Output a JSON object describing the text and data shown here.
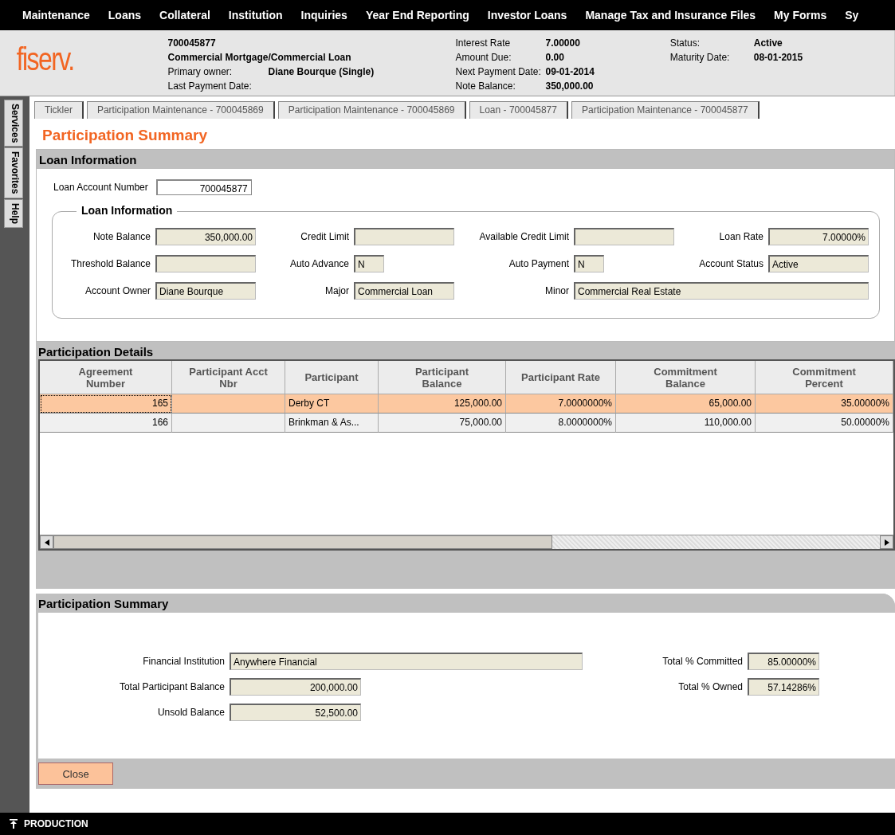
{
  "menu": [
    "Maintenance",
    "Loans",
    "Collateral",
    "Institution",
    "Inquiries",
    "Year End Reporting",
    "Investor Loans",
    "Manage Tax and Insurance Files",
    "My Forms",
    "Sy"
  ],
  "header": {
    "logo": "fiserv.",
    "account": "700045877",
    "loan_type": "Commercial Mortgage/Commercial Loan",
    "col1": [
      {
        "label": "Primary owner:",
        "value": "Diane Bourque (Single)"
      },
      {
        "label": "Last Payment Date:"
      }
    ],
    "col2": [
      {
        "label": "Interest Rate",
        "value": "7.00000"
      },
      {
        "label": "Amount Due:",
        "value": "0.00"
      },
      {
        "label": "Next Payment Date:",
        "value": "09-01-2014"
      },
      {
        "label": "Note Balance:",
        "value": "350,000.00"
      }
    ],
    "col3": [
      {
        "label": "Status:",
        "value": "Active"
      },
      {
        "label": "Maturity Date:",
        "value": "08-01-2015"
      }
    ]
  },
  "side_tabs": [
    "Services",
    "Favorites",
    "Help"
  ],
  "tabs": [
    "Tickler",
    "Participation Maintenance - 700045869",
    "Participation Maintenance - 700045869",
    "Loan - 700045877",
    "Participation Maintenance - 700045877"
  ],
  "page_title": "Participation Summary",
  "loan_section": {
    "title": "Loan Information",
    "account_label": "Loan Account Number",
    "account_value": "700045877",
    "group_title": "Loan Information",
    "fields": [
      {
        "label": "Note Balance",
        "value": "350,000.00",
        "kind": "number"
      },
      {
        "label": "Credit Limit",
        "kind": "number"
      },
      {
        "label": "Available Credit Limit",
        "kind": "number"
      },
      {
        "label": "Loan Rate",
        "value": "7.00000%",
        "kind": "number"
      },
      {
        "label": "Threshold Balance",
        "kind": "number"
      },
      {
        "label": "Auto Advance",
        "value": "N",
        "kind": "flag"
      },
      {
        "label": "Auto Payment",
        "value": "N",
        "kind": "flag"
      },
      {
        "label": "Account Status",
        "value": "Active",
        "kind": "text"
      },
      {
        "label": "Account Owner",
        "value": "Diane Bourque",
        "kind": "text"
      },
      {
        "label": "Major",
        "value": "Commercial Loan",
        "kind": "text"
      },
      {
        "label": "Minor",
        "value": "Commercial Real Estate",
        "kind": "wide"
      }
    ]
  },
  "details": {
    "title": "Participation Details",
    "columns": [
      "Agreement Number",
      "Participant Acct Nbr",
      "Participant",
      "Participant Balance",
      "Participant Rate",
      "Commitment Balance",
      "Commitment Percent"
    ],
    "rows": [
      {
        "selected": true,
        "cells": [
          "165",
          "",
          "Derby CT",
          "125,000.00",
          "7.0000000%",
          "65,000.00",
          "35.00000%"
        ]
      },
      {
        "selected": false,
        "cells": [
          "166",
          "",
          "Brinkman & As...",
          "75,000.00",
          "8.0000000%",
          "110,000.00",
          "50.00000%"
        ]
      }
    ]
  },
  "summary": {
    "title": "Participation Summary",
    "left": [
      {
        "label": "Financial Institution",
        "value": "Anywhere Financial",
        "kind": "wide"
      },
      {
        "label": "Total Participant Balance",
        "value": "200,000.00",
        "kind": "number"
      },
      {
        "label": "Unsold Balance",
        "value": "52,500.00",
        "kind": "number"
      }
    ],
    "right": [
      {
        "label": "Total % Committed",
        "value": "85.00000%"
      },
      {
        "label": "Total % Owned",
        "value": "57.14286%"
      }
    ]
  },
  "close_button": "Close",
  "status_bar": "PRODUCTION"
}
